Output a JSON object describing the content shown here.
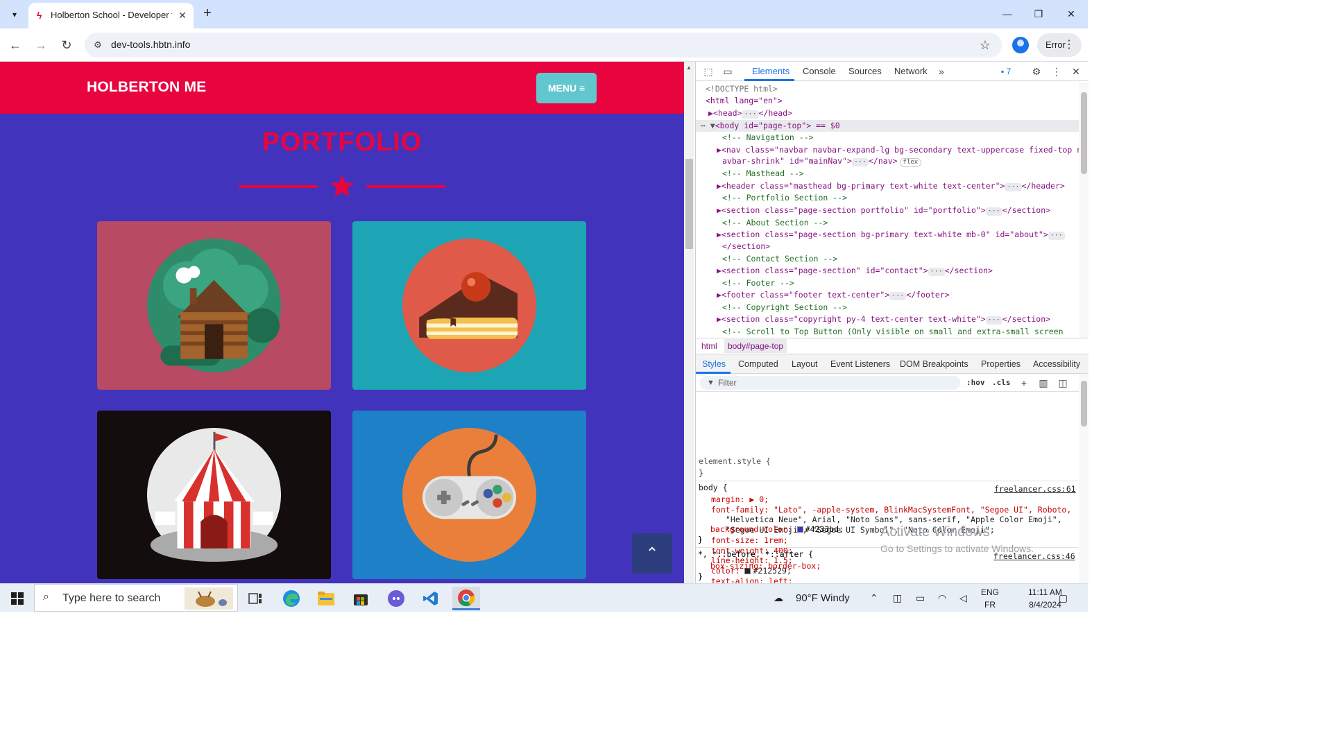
{
  "browser": {
    "tab_title": "Holberton School - Developer t",
    "url": "dev-tools.hbtn.info",
    "profile_chip": "Error"
  },
  "site": {
    "brand": "HOLBERTON ME",
    "menu_label": "MENU",
    "section_title": "PORTFOLIO",
    "cards": [
      {
        "name": "cabin",
        "bg": "#b84a64"
      },
      {
        "name": "cake",
        "bg": "#1da5b5"
      },
      {
        "name": "circus-tent",
        "bg": "#130d0d"
      },
      {
        "name": "game-controller",
        "bg": "#1e80c7"
      }
    ],
    "colors": {
      "primary": "#4233bd",
      "accent": "#e8053f"
    }
  },
  "devtools": {
    "tabs": [
      "Elements",
      "Console",
      "Sources",
      "Network"
    ],
    "message_count": "7",
    "dom": [
      "<!DOCTYPE html>",
      "<html lang=\"en\">",
      "<head>",
      "<body id=\"page-top\"> == $0",
      "<!-- Navigation -->",
      "<nav class=\"navbar navbar-expand-lg bg-secondary text-uppercase fixed-top n",
      "avbar-shrink\" id=\"mainNav\">",
      "<!-- Masthead -->",
      "<header class=\"masthead bg-primary text-white text-center\">",
      "<!-- Portfolio Section -->",
      "<section class=\"page-section portfolio\" id=\"portfolio\">",
      "<!-- About Section -->",
      "<section class=\"page-section bg-primary text-white mb-0\" id=\"about\">",
      "</section>",
      "<!-- Contact Section -->",
      "<section class=\"page-section\" id=\"contact\">",
      "<!-- Footer -->",
      "<footer class=\"footer text-center\">",
      "<!-- Copyright Section -->",
      "<section class=\"copyright py-4 text-center text-white\">",
      "<!-- Scroll to Top Button (Only visible on small and extra-small screen"
    ],
    "breadcrumbs": [
      "html",
      "body#page-top"
    ],
    "style_tabs": [
      "Styles",
      "Computed",
      "Layout",
      "Event Listeners",
      "DOM Breakpoints",
      "Properties",
      "Accessibility"
    ],
    "filter_placeholder": "Filter",
    "hov": ":hov",
    "cls": ".cls",
    "styles": {
      "element_style": "element.style {",
      "body_selector": "body {",
      "body_source": "freelancer.css:61",
      "margin": "margin: ▶ 0;",
      "font_family_1": "font-family: \"Lato\", -apple-system, BlinkMacSystemFont, \"Segoe UI\", Roboto,",
      "font_family_2": "\"Helvetica Neue\", Arial, \"Noto Sans\", sans-serif, \"Apple Color Emoji\",",
      "font_family_3": "\"Segoe UI Emoji\", \"Segoe UI Symbol\", \"Noto Color Emoji\";",
      "font_size": "font-size: 1rem;",
      "font_weight": "font-weight: 400;",
      "line_height": "line-height: 1.5;",
      "color_prop": "color:",
      "color_val": "#212529;",
      "text_align": "text-align: left;",
      "bg_prop": "background-color:",
      "bg_val": "#4233bd;",
      "universal_selector": "*, *::before, *::after {",
      "universal_source": "freelancer.css:46",
      "box_sizing": "box-sizing: border-box;"
    }
  },
  "watermark": {
    "title": "Activate Windows",
    "subtitle": "Go to Settings to activate Windows."
  },
  "taskbar": {
    "search_placeholder": "Type here to search",
    "weather": "90°F  Windy",
    "lang_top": "ENG",
    "lang_bottom": "FR",
    "time": "11:11 AM",
    "date": "8/4/2024"
  }
}
